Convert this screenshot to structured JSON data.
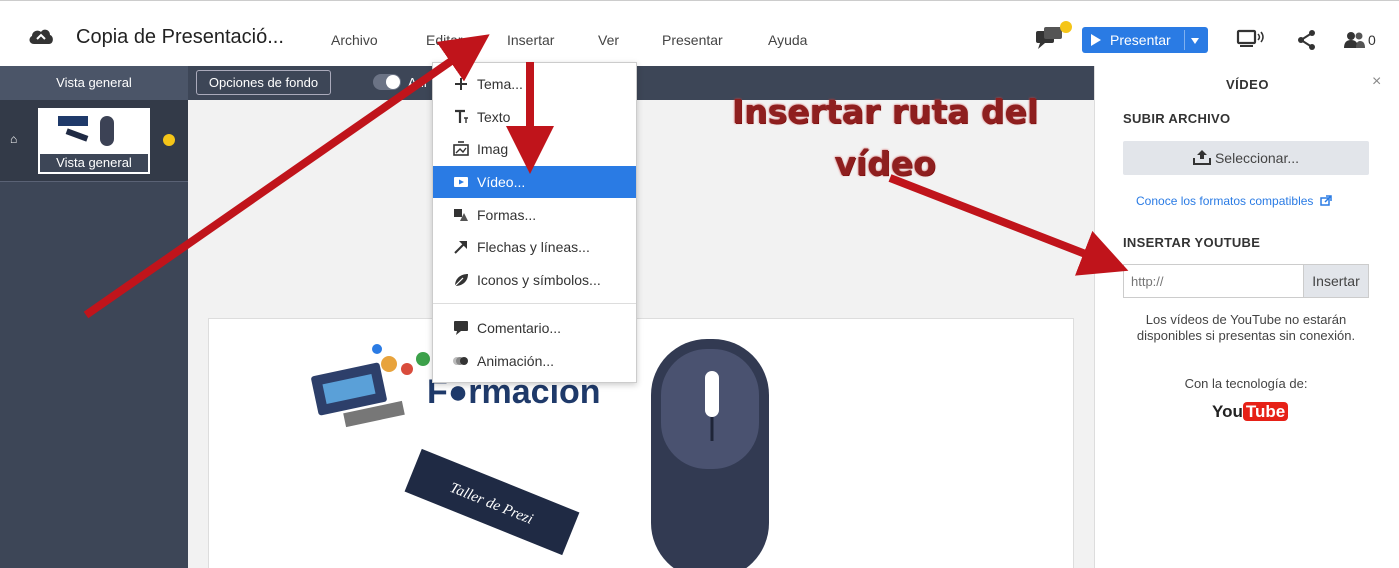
{
  "topbar": {
    "doc_title": "Copia de Presentació...",
    "menu": [
      "Archivo",
      "Editar",
      "Insertar",
      "Ver",
      "Presentar",
      "Ayuda"
    ],
    "present_label": "Presentar",
    "collaborators_count": "0"
  },
  "left": {
    "header": "Vista general",
    "thumb_label": "Vista general"
  },
  "canvas_toolbar": {
    "bg_options": "Opciones de fondo",
    "anim_label": "Ani"
  },
  "dropdown": {
    "items": [
      {
        "label": "Tema...",
        "icon": "plus-icon"
      },
      {
        "label": "Texto",
        "icon": "text-icon"
      },
      {
        "label": "Imag",
        "icon": "image-icon"
      },
      {
        "label": "Vídeo...",
        "icon": "video-icon",
        "active": true
      },
      {
        "label": "Formas...",
        "icon": "shapes-icon"
      },
      {
        "label": "Flechas y líneas...",
        "icon": "arrow-icon"
      },
      {
        "label": "Iconos y símbolos...",
        "icon": "leaf-icon"
      },
      {
        "label": "Comentario...",
        "icon": "comment-icon"
      },
      {
        "label": "Animación...",
        "icon": "animation-icon"
      }
    ]
  },
  "slide": {
    "logo_text": "F●rmación",
    "banner_text": "Taller de Prezi"
  },
  "annotation": {
    "line1": "Insertar ruta del",
    "line2": "vídeo"
  },
  "right_panel": {
    "title": "VÍDEO",
    "close": "×",
    "upload_heading": "SUBIR ARCHIVO",
    "upload_button": "Seleccionar...",
    "formats_link": "Conoce los formatos compatibles",
    "youtube_heading": "INSERTAR YOUTUBE",
    "url_placeholder": "http://",
    "insert_button": "Insertar",
    "note": "Los vídeos de YouTube no estarán disponibles si presentas sin conexión.",
    "powered_by": "Con la tecnología de:",
    "yt_you": "You",
    "yt_tube": "Tube"
  },
  "colors": {
    "accent": "#2a7be4",
    "dark_panel": "#3d4657",
    "annotation": "#8e1f1f",
    "arrow": "#c0141b",
    "notification": "#f5c518"
  }
}
